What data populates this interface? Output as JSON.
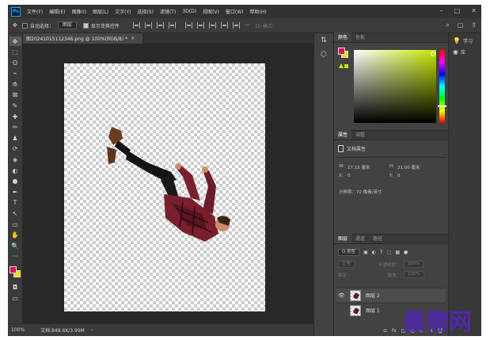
{
  "menubar": {
    "logo": "Ps",
    "items": [
      "文件(F)",
      "编辑(E)",
      "图像(I)",
      "图层(L)",
      "文字(Y)",
      "选择(S)",
      "滤镜(T)",
      "3D(D)",
      "视图(V)",
      "窗口(W)",
      "帮助(H)"
    ],
    "window_controls": [
      "–",
      "□",
      "✕"
    ]
  },
  "options": {
    "move_icon": "✥",
    "auto_select_label": "自动选择：",
    "auto_select_value": "图层",
    "show_transform_label": "显示变换控件",
    "more": "···",
    "mode_3d_label": "3D 模式：",
    "right_icons": [
      "⌕",
      "▢",
      "⇧"
    ]
  },
  "document": {
    "tab_title": "图20241015112346.png @ 100%(RGB/8) *",
    "tab_close": "×",
    "zoom": "100%",
    "doc_size": "文档:848.6K/3.99M",
    "status_arrow": "›"
  },
  "tools": [
    "✥",
    "⬚",
    "ʘ",
    "⌁",
    "⟰",
    "⊠",
    "✎",
    "✚",
    "✏",
    "♟",
    "⟳",
    "◈",
    "◐",
    "●",
    "✒",
    "T",
    "↖",
    "▭",
    "✋",
    "🔍",
    "···"
  ],
  "panel_icons": [
    "⇅",
    "⬡"
  ],
  "color_panel": {
    "tabs": [
      "颜色",
      "色板"
    ],
    "fg_color": "#d4145a",
    "bg_color": "#e6e200",
    "field_hue_color": "#c6e600"
  },
  "properties": {
    "tabs": [
      "属性",
      "调整"
    ],
    "title": "文档属性",
    "width_label": "W:",
    "width_value": "17.15 厘米",
    "height_label": "H:",
    "height_value": "21.00 厘米",
    "x_label": "X:",
    "x_value": "0",
    "y_label": "Y:",
    "y_value": "0",
    "resolution": "分辨率：72 像素/英寸"
  },
  "layers": {
    "tabs": [
      "图层",
      "通道",
      "路径"
    ],
    "filter_value": "Q 类型",
    "filter_icons": [
      "▣",
      "◐",
      "T",
      "⬚",
      "▦",
      "●"
    ],
    "blend_mode": "正常",
    "opacity_label": "不透明度：",
    "opacity_value": "100%",
    "lock_label": "锁定：",
    "fill_label": "填充：",
    "fill_value": "100%",
    "items": [
      {
        "name": "图层 2",
        "visible": true,
        "selected": true
      },
      {
        "name": "图层 1",
        "visible": false,
        "selected": false
      }
    ],
    "footer_icons": [
      "⊝",
      "fx",
      "◫",
      "◑",
      "▭",
      "⊞",
      "🗑"
    ]
  },
  "learn_panel": {
    "items": [
      {
        "icon": "💡",
        "label": "学习"
      },
      {
        "icon": "◉",
        "label": "库"
      }
    ]
  },
  "watermark": "最需网"
}
